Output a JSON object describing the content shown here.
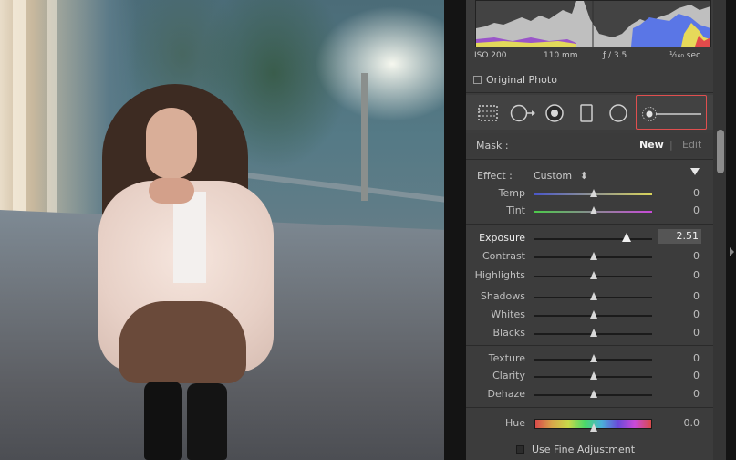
{
  "exif": {
    "iso": "ISO 200",
    "focal": "110 mm",
    "aperture": "ƒ / 3.5",
    "shutter": "¹⁄₁₆₀ sec"
  },
  "original_photo": {
    "label": "Original Photo",
    "checked": false
  },
  "tools": [
    "crop-overlay-icon",
    "spot-removal-icon",
    "red-eye-icon",
    "graduated-filter-icon",
    "radial-filter-icon",
    "adjustment-brush-icon"
  ],
  "mask": {
    "label": "Mask :",
    "new": "New",
    "sep": "|",
    "edit": "Edit"
  },
  "effect": {
    "label": "Effect :",
    "value": "Custom",
    "arrows": "⬍"
  },
  "sliders": {
    "temp": {
      "label": "Temp",
      "value": "0",
      "position": 0.5
    },
    "tint": {
      "label": "Tint",
      "value": "0",
      "position": 0.5
    },
    "exposure": {
      "label": "Exposure",
      "value": "2.51",
      "position": 0.78
    },
    "contrast": {
      "label": "Contrast",
      "value": "0",
      "position": 0.5
    },
    "highlights": {
      "label": "Highlights",
      "value": "0",
      "position": 0.5
    },
    "shadows": {
      "label": "Shadows",
      "value": "0",
      "position": 0.5
    },
    "whites": {
      "label": "Whites",
      "value": "0",
      "position": 0.5
    },
    "blacks": {
      "label": "Blacks",
      "value": "0",
      "position": 0.5
    },
    "texture": {
      "label": "Texture",
      "value": "0",
      "position": 0.5
    },
    "clarity": {
      "label": "Clarity",
      "value": "0",
      "position": 0.5
    },
    "dehaze": {
      "label": "Dehaze",
      "value": "0",
      "position": 0.5
    },
    "hue": {
      "label": "Hue",
      "value": "0.0",
      "position": 0.5
    }
  },
  "fine_adjustment": {
    "label": "Use Fine Adjustment",
    "checked": false
  },
  "colors": {
    "highlight": "#e04f4f",
    "panel": "#3c3c3c"
  }
}
